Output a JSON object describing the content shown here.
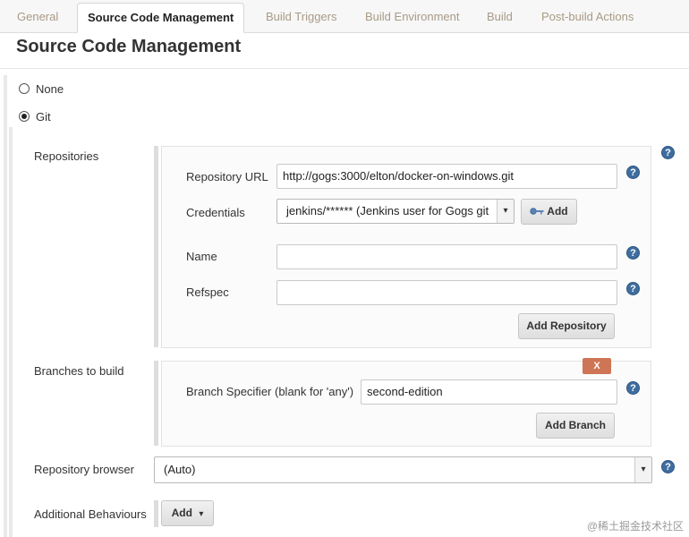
{
  "tabs": [
    {
      "label": "General"
    },
    {
      "label": "Source Code Management"
    },
    {
      "label": "Build Triggers"
    },
    {
      "label": "Build Environment"
    },
    {
      "label": "Build"
    },
    {
      "label": "Post-build Actions"
    }
  ],
  "active_tab": "Source Code Management",
  "section_title": "Source Code Management",
  "scm_options": {
    "none_label": "None",
    "git_label": "Git",
    "selected": "Git"
  },
  "repositories": {
    "label": "Repositories",
    "url_label": "Repository URL",
    "url_value": "http://gogs:3000/elton/docker-on-windows.git",
    "credentials_label": "Credentials",
    "credentials_value": "jenkins/****** (Jenkins user for Gogs git",
    "credentials_add_label": "Add",
    "name_label": "Name",
    "name_value": "",
    "refspec_label": "Refspec",
    "refspec_value": "",
    "add_repository_label": "Add Repository"
  },
  "branches": {
    "label": "Branches to build",
    "delete_label": "X",
    "specifier_label": "Branch Specifier (blank for 'any')",
    "specifier_value": "second-edition",
    "add_branch_label": "Add Branch"
  },
  "repository_browser": {
    "label": "Repository browser",
    "value": "(Auto)"
  },
  "additional_behaviours": {
    "label": "Additional Behaviours",
    "add_label": "Add"
  },
  "help_glyph": "?",
  "dropdown_glyph": "▾",
  "watermark": "@稀土掘金技术社区"
}
